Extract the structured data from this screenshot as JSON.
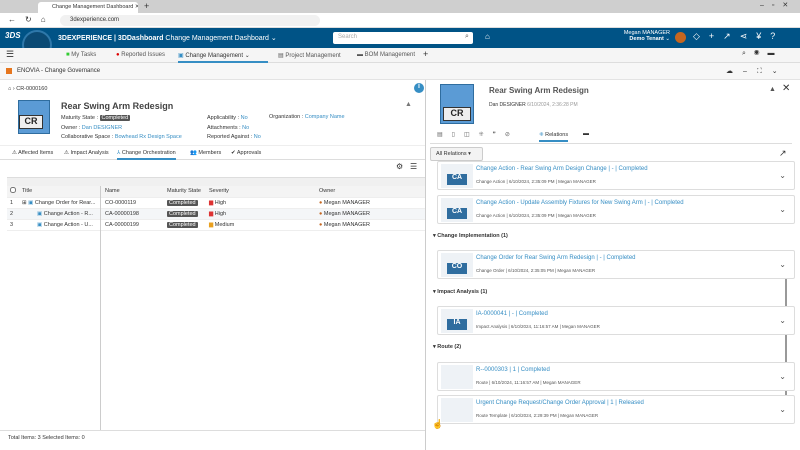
{
  "browser": {
    "tab_title": "Change Management Dashboard",
    "url": "3dexperience.com"
  },
  "header": {
    "brand": "3DEXPERIENCE | 3DDashboard",
    "dashboard": "Change Management Dashboard",
    "search_placeholder": "Search",
    "user": "Megan MANAGER",
    "tenant": "Demo Tenant"
  },
  "nav": {
    "tabs": [
      "My Tasks",
      "Reported Issues",
      "Change Management",
      "Project Management",
      "BOM Management"
    ]
  },
  "app": {
    "title": "ENOVIA - Change Governance"
  },
  "left": {
    "breadcrumb": "CR-0000160",
    "icon_label": "CR",
    "title": "Rear Swing Arm Redesign",
    "maturity_label": "Maturity State :",
    "maturity": "Completed",
    "owner_label": "Owner :",
    "owner": "Dan DESIGNER",
    "space_label": "Collaborative Space :",
    "space": "Bowhead Rx Design Space",
    "applicability_label": "Applicability :",
    "applicability": "No",
    "attachments_label": "Attachments :",
    "attachments": "No",
    "reported_label": "Reported Against :",
    "reported": "No",
    "org_label": "Organization :",
    "org": "Company Name",
    "tabs": [
      "Affected Items",
      "Impact Analysis",
      "Change Orchestration",
      "Members",
      "Approvals"
    ],
    "columns": [
      "Title",
      "Name",
      "Maturity State",
      "Severity",
      "Owner"
    ],
    "rows": [
      {
        "n": "1",
        "title": "Change Order for Rear...",
        "name": "CO-0000119",
        "state": "Completed",
        "sev": "High",
        "owner": "Megan MANAGER"
      },
      {
        "n": "2",
        "title": "Change Action - R...",
        "name": "CA-00000198",
        "state": "Completed",
        "sev": "High",
        "owner": "Megan MANAGER"
      },
      {
        "n": "3",
        "title": "Change Action - U...",
        "name": "CA-00000199",
        "state": "Completed",
        "sev": "Medium",
        "owner": "Megan MANAGER"
      }
    ],
    "footer": "Total Items: 3   Selected Items: 0"
  },
  "right": {
    "title": "Rear Swing Arm Redesign",
    "author": "Dan DESIGNER",
    "date": "6/10/2024, 2:36:28 PM",
    "tab_active": "Relations",
    "filter": "All Relations",
    "sections": [
      {
        "name": "",
        "items": [
          {
            "icon": "CA",
            "title": "Change Action - Rear Swing Arm Design Change | - | Completed",
            "sub": "Change Action | 6/10/2024, 2:35:09 PM | Megan MANAGER"
          },
          {
            "icon": "CA",
            "title": "Change Action - Update Assembly Fixtures for New Swing Arm | - | Completed",
            "sub": "Change Action | 6/10/2024, 2:35:09 PM | Megan MANAGER"
          }
        ]
      },
      {
        "name": "Change Implementation (1)",
        "items": [
          {
            "icon": "CO",
            "title": "Change Order for Rear Swing Arm Redesign | - | Completed",
            "sub": "Change Order | 6/10/2024, 2:35:05 PM | Megan MANAGER"
          }
        ]
      },
      {
        "name": "Impact Analysis (1)",
        "items": [
          {
            "icon": "IA",
            "title": "IA-0000041 | - | Completed",
            "sub": "Impact Analysis | 6/10/2024, 11:16:57 AM | Megan MANAGER"
          }
        ]
      },
      {
        "name": "Route (2)",
        "items": [
          {
            "icon": "",
            "title": "R--0000303 | 1 | Completed",
            "sub": "Route | 6/10/2024, 11:16:57 AM | Megan MANAGER"
          },
          {
            "icon": "",
            "title": "Urgent Change Request/Change Order Approval | 1 | Released",
            "sub": "Route Template | 6/10/2024, 2:29:39 PM | Megan MANAGER"
          }
        ]
      }
    ]
  }
}
